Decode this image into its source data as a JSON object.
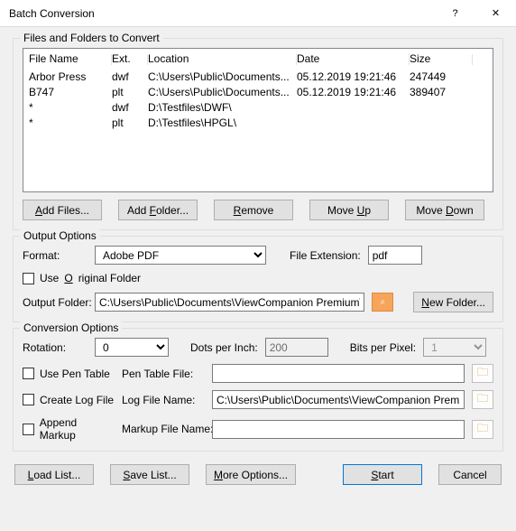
{
  "window": {
    "title": "Batch Conversion",
    "help": "?",
    "close": "✕"
  },
  "files_group": {
    "legend": "Files and Folders to Convert",
    "headers": {
      "name": "File Name",
      "ext": "Ext.",
      "loc": "Location",
      "date": "Date",
      "size": "Size"
    },
    "rows": [
      {
        "name": "Arbor Press",
        "ext": "dwf",
        "loc": "C:\\Users\\Public\\Documents...",
        "date": "05.12.2019  19:21:46",
        "size": "247449"
      },
      {
        "name": "B747",
        "ext": "plt",
        "loc": "C:\\Users\\Public\\Documents...",
        "date": "05.12.2019  19:21:46",
        "size": "389407"
      },
      {
        "name": "*",
        "ext": "dwf",
        "loc": "D:\\Testfiles\\DWF\\",
        "date": "",
        "size": ""
      },
      {
        "name": "*",
        "ext": "plt",
        "loc": "D:\\Testfiles\\HPGL\\",
        "date": "",
        "size": ""
      }
    ],
    "buttons": {
      "add_files": "Add Files...",
      "add_folder": "Add Folder...",
      "remove": "Remove",
      "move_up": "Move Up",
      "move_down": "Move Down"
    }
  },
  "output": {
    "legend": "Output Options",
    "format_label": "Format:",
    "format_value": "Adobe PDF",
    "ext_label": "File Extension:",
    "ext_value": "pdf",
    "use_original": "Use Original Folder",
    "folder_label": "Output Folder:",
    "folder_value": "C:\\Users\\Public\\Documents\\ViewCompanion Premium\\Export",
    "new_folder": "New Folder..."
  },
  "conv": {
    "legend": "Conversion Options",
    "rotation_label": "Rotation:",
    "rotation_value": "0",
    "dpi_label": "Dots per Inch:",
    "dpi_value": "200",
    "bpp_label": "Bits per Pixel:",
    "bpp_value": "1",
    "use_pen": "Use Pen Table",
    "pen_file_label": "Pen Table File:",
    "pen_file_value": "",
    "create_log": "Create Log File",
    "log_label": "Log File Name:",
    "log_value": "C:\\Users\\Public\\Documents\\ViewCompanion Premium\\Rep",
    "append_markup": "Append Markup",
    "markup_label": "Markup File Name:",
    "markup_value": ""
  },
  "bottom": {
    "load_list": "Load List...",
    "save_list": "Save List...",
    "more_options": "More Options...",
    "start": "Start",
    "cancel": "Cancel"
  }
}
